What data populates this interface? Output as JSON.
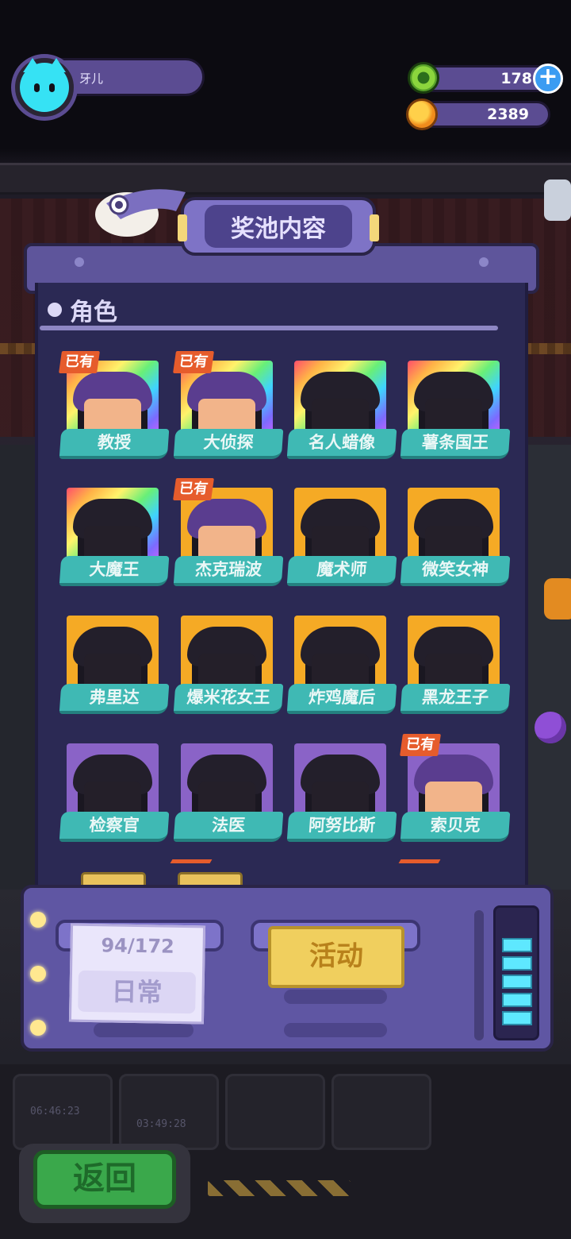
{
  "player": {
    "name": "牙儿",
    "avatar_icon": "cat-avatar-icon"
  },
  "currencies": [
    {
      "icon": "green-gem-icon",
      "value": "178"
    },
    {
      "icon": "planet-coin-icon",
      "value": "2389"
    }
  ],
  "panel": {
    "title": "奖池内容",
    "section": "角色"
  },
  "owned_label": "已有",
  "characters": [
    {
      "name": "教授",
      "frame": "rainbow",
      "owned": true
    },
    {
      "name": "大侦探",
      "frame": "rainbow",
      "owned": true
    },
    {
      "name": "名人蜡像",
      "frame": "rainbow",
      "owned": false
    },
    {
      "name": "薯条国王",
      "frame": "rainbow",
      "owned": false
    },
    {
      "name": "大魔王",
      "frame": "rainbow",
      "owned": false
    },
    {
      "name": "杰克瑞波",
      "frame": "orange",
      "owned": true
    },
    {
      "name": "魔术师",
      "frame": "orange",
      "owned": false
    },
    {
      "name": "微笑女神",
      "frame": "orange",
      "owned": false
    },
    {
      "name": "弗里达",
      "frame": "orange",
      "owned": false
    },
    {
      "name": "爆米花女王",
      "frame": "orange",
      "owned": false
    },
    {
      "name": "炸鸡魔后",
      "frame": "orange",
      "owned": false
    },
    {
      "name": "黑龙王子",
      "frame": "orange",
      "owned": false
    },
    {
      "name": "检察官",
      "frame": "purple",
      "owned": false
    },
    {
      "name": "法医",
      "frame": "purple",
      "owned": false
    },
    {
      "name": "阿努比斯",
      "frame": "purple",
      "owned": false
    },
    {
      "name": "索贝克",
      "frame": "purple",
      "owned": true
    }
  ],
  "deck": {
    "progress_text": "94/172",
    "tab_normal": "日常",
    "tab_event": "活动",
    "meter_filled": 5,
    "meter_total": 5
  },
  "back_button": "返回",
  "background_timers": [
    "06:46:23",
    "03:49:28"
  ],
  "colors": {
    "panel": "#2b2954",
    "name_bar": "#3fb9b4",
    "owned_badge": "#e65c2c",
    "event_tab": "#f0cf5e"
  }
}
